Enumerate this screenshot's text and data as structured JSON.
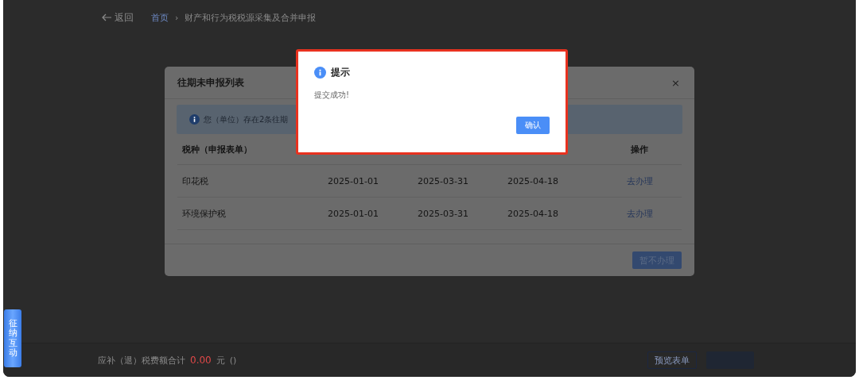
{
  "breadcrumb": {
    "back": "返回",
    "home": "首页",
    "separator": "›",
    "current": "财产和行为税税源采集及合并申报"
  },
  "side_tab": {
    "label": "征纳互动"
  },
  "footer": {
    "label": "应补（退）税费额合计",
    "amount": "0.00",
    "unit": "元",
    "note": "()",
    "buttons": [
      {
        "label": "预览表单",
        "kind": "outline"
      },
      {
        "kind": "filled"
      }
    ]
  },
  "list_dialog": {
    "title": "往期未申报列表",
    "close": "×",
    "notice": "您（单位）存在2条往期",
    "columns": [
      {
        "label": "税种（申报表单）"
      },
      {},
      {},
      {},
      {
        "label": "操作"
      }
    ],
    "rows": [
      {
        "cells": [
          "印花税",
          "2025-01-01",
          "2025-03-31",
          "2025-04-18"
        ],
        "action": "去办理"
      },
      {
        "cells": [
          "环境保护税",
          "2025-01-01",
          "2025-03-31",
          "2025-04-18"
        ],
        "action": "去办理"
      }
    ],
    "button": "暂不办理"
  },
  "alert": {
    "title": "提示",
    "message": "提交成功!",
    "button": "确认"
  }
}
